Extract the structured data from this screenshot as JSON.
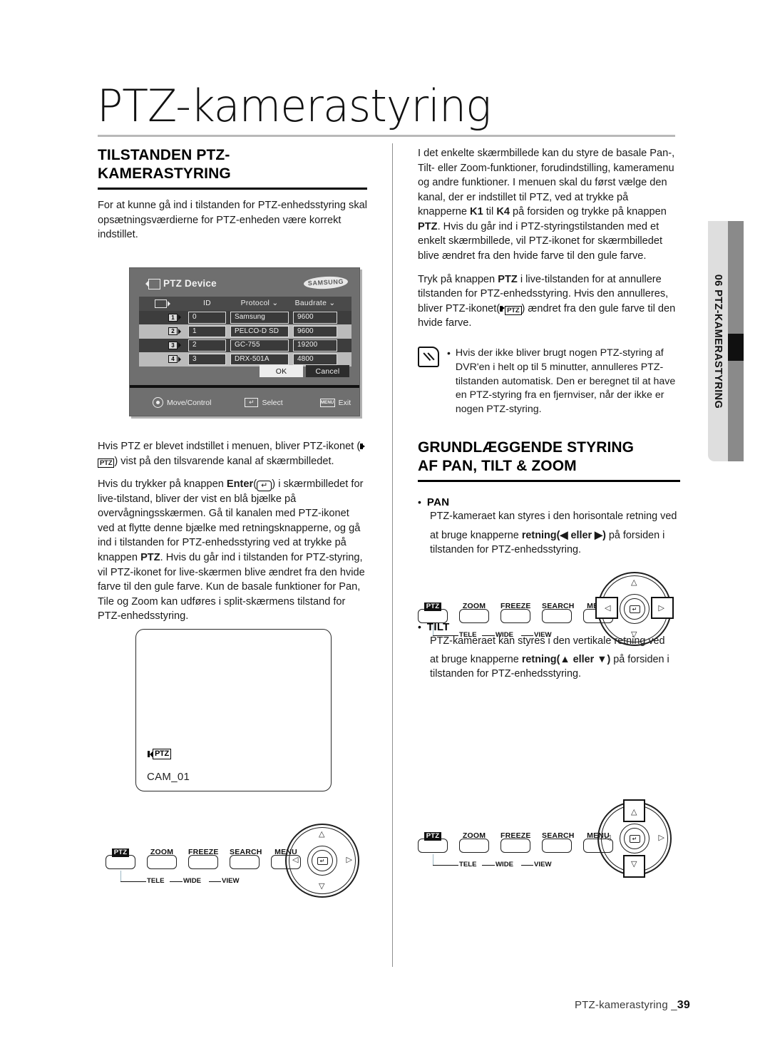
{
  "header": {
    "title": "PTZ-kamerastyring"
  },
  "left": {
    "section_title_line1": "TILSTANDEN PTZ-",
    "section_title_line2": "KAMERASTYRING",
    "intro": "For at kunne gå ind i tilstanden for PTZ-enhedsstyring skal opsætningsværdierne for PTZ-enheden være korrekt indstillet.",
    "para_icon_pre": "Hvis PTZ er blevet indstillet i menuen, bliver PTZ-ikonet (",
    "para_icon_post": ") vist på den tilsvarende kanal af skærmbilledet.",
    "para_enter_pre": "Hvis du trykker på knappen ",
    "para_enter_bold": "Enter",
    "para_enter_key": "↵",
    "para_enter_mid": ") i skærmbilledet for live-tilstand, bliver der vist en blå bjælke på overvågningsskærmen. Gå til kanalen med PTZ-ikonet ved at flytte denne bjælke med retningsknapperne, og gå ind i tilstanden for PTZ-enhedsstyring ved at trykke på knappen ",
    "para_enter_bold2": "PTZ",
    "para_enter_end": ". Hvis du går ind i tilstanden for PTZ-styring, vil PTZ-ikonet for live-skærmen blive ændret fra den hvide farve til den gule farve. Kun de basale funktioner for Pan, Tile og Zoom kan udføres i split-skærmens tilstand for PTZ-enhedsstyring."
  },
  "osd": {
    "title": "PTZ Device",
    "brand": "SAMSUNG",
    "columns": [
      "",
      "ID",
      "Protocol",
      "Baudrate"
    ],
    "rows": [
      {
        "cam": "1",
        "id": "0",
        "protocol": "Samsung",
        "baudrate": "9600"
      },
      {
        "cam": "2",
        "id": "1",
        "protocol": "PELCO-D SD",
        "baudrate": "9600"
      },
      {
        "cam": "3",
        "id": "2",
        "protocol": "GC-755",
        "baudrate": "19200"
      },
      {
        "cam": "4",
        "id": "3",
        "protocol": "DRX-501A",
        "baudrate": "4800"
      }
    ],
    "ok_label": "OK",
    "cancel_label": "Cancel",
    "foot_move": "Move/Control",
    "foot_select": "Select",
    "foot_exit": "Exit",
    "foot_menu_key": "MENU",
    "foot_enter_key": "↵"
  },
  "monitor": {
    "ptz_chip": "PTZ",
    "channel_name": "CAM_01"
  },
  "panel": {
    "buttons": [
      "PTZ",
      "ZOOM",
      "FREEZE",
      "SEARCH",
      "MENU"
    ],
    "sub_labels": [
      "TELE",
      "WIDE",
      "VIEW"
    ],
    "enter_key": "↵",
    "arrows": {
      "up": "△",
      "down": "▽",
      "left": "◁",
      "right": "▷"
    }
  },
  "right": {
    "para1": "I det enkelte skærmbillede kan du styre de basale Pan-, Tilt- eller Zoom-funktioner, forudindstilling, kameramenu og andre funktioner. I menuen skal du først vælge den kanal, der er indstillet til PTZ, ved at trykke på knapperne ",
    "para1_k1": "K1",
    "para1_til": " til ",
    "para1_k4": "K4",
    "para1_mid": " på forsiden og trykke på knappen ",
    "para1_ptz": "PTZ",
    "para1_end": ". Hvis du går ind i PTZ-styringstilstanden med et enkelt skærmbillede, vil PTZ-ikonet for skærmbilledet blive ændret fra den hvide farve til den gule farve.",
    "para2_pre": "Tryk på knappen ",
    "para2_ptz": "PTZ",
    "para2_mid": " i live-tilstanden for at annullere tilstanden for PTZ-enhedsstyring. Hvis den annulleres, bliver PTZ-ikonet(",
    "para2_end": ") ændret fra den gule farve til den hvide farve.",
    "note": "Hvis der ikke bliver brugt nogen PTZ-styring af DVR'en i helt op til 5 minutter, annulleres PTZ-tilstanden automatisk. Den er beregnet til at have en PTZ-styring fra en fjernviser, når der ikke er nogen PTZ-styring.",
    "note_bullet": "•",
    "section2_line1": "GRUNDLÆGGENDE STYRING",
    "section2_line2": "AF PAN, TILT & ZOOM",
    "pan_heading": "PAN",
    "pan_text_pre": "PTZ-kameraet kan styres i den horisontale retning ved",
    "pan_text_2a": "at bruge knapperne ",
    "pan_text_bold": "retning",
    "pan_text_arrows": "(◀ eller ▶)",
    "pan_text_2b": " på forsiden i",
    "pan_text_3": "tilstanden for PTZ-enhedsstyring.",
    "tilt_heading": "TILT",
    "tilt_text_pre": "PTZ-kameraet kan styres i den vertikale retning ved",
    "tilt_text_2a": "at bruge knapperne ",
    "tilt_text_bold": "retning",
    "tilt_text_arrows": "(▲ eller ▼)",
    "tilt_text_2b": " på forsiden i",
    "tilt_text_3": "tilstanden for PTZ-enhedsstyring."
  },
  "sidetab": {
    "label": "06 PTZ-KAMERASTYRING"
  },
  "footer": {
    "text": "PTZ-kamerastyring _",
    "page": "39"
  }
}
